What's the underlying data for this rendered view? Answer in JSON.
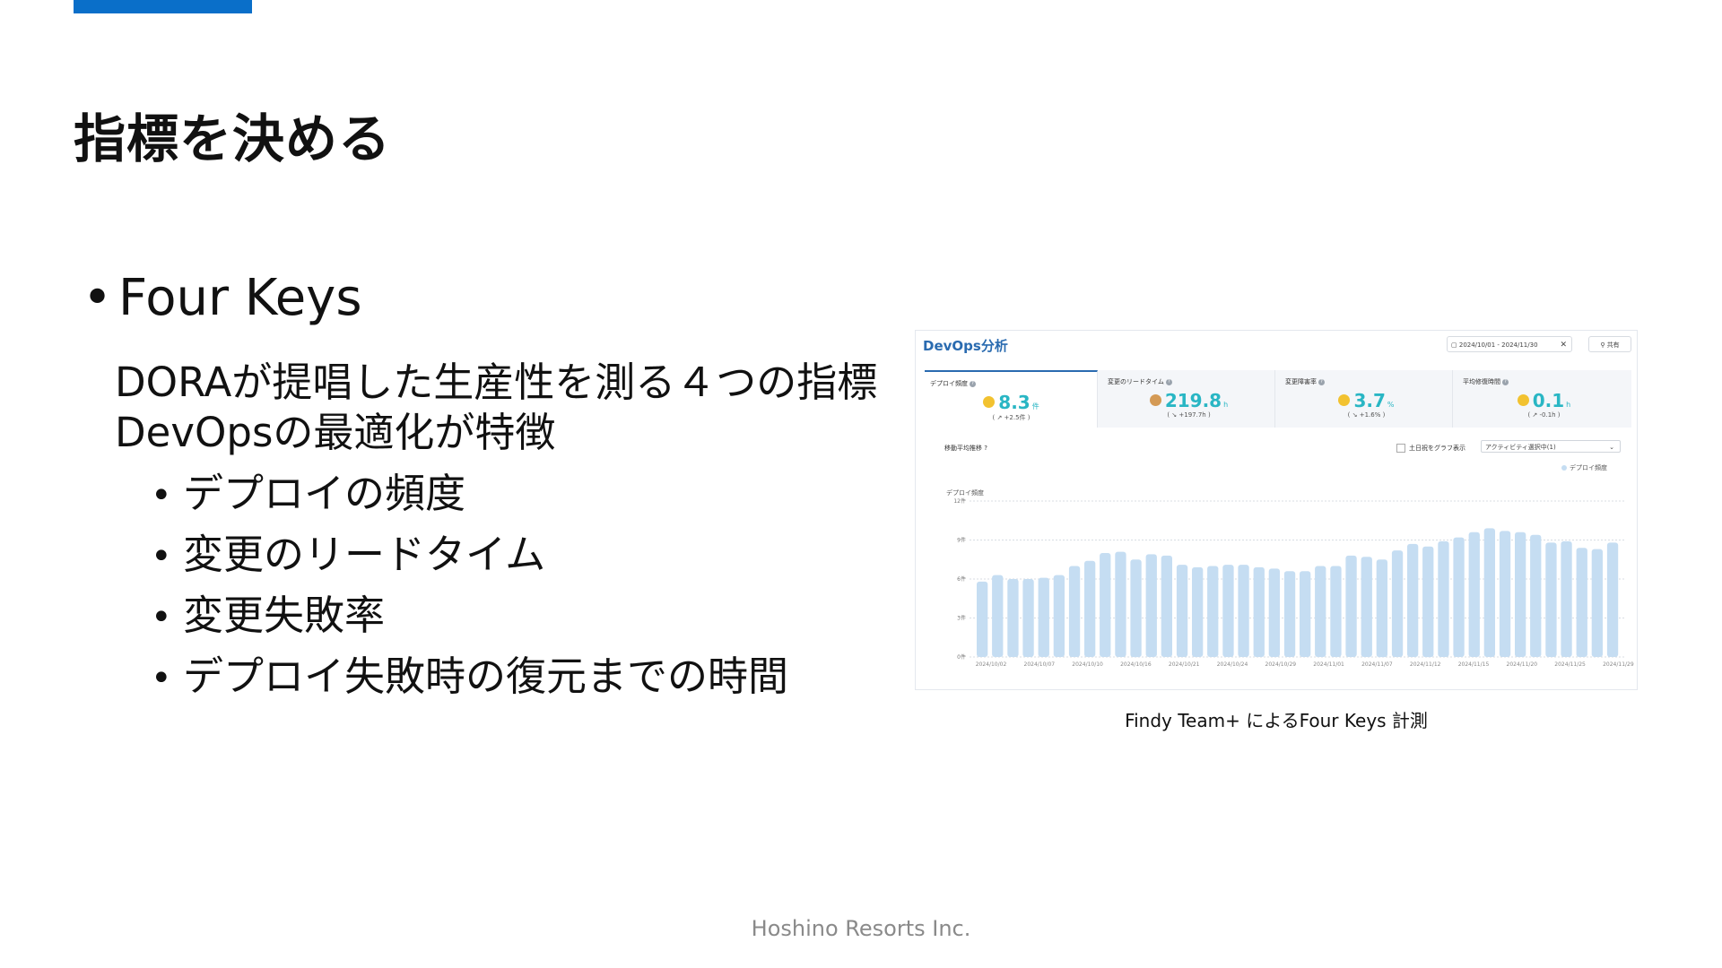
{
  "slide": {
    "title": "指標を決める",
    "bullet1": "Four Keys",
    "description": [
      "DORAが提唱した生産性を測る４つの指標",
      "DevOpsの最適化が特徴"
    ],
    "subitems": [
      "デプロイの頻度",
      "変更のリードタイム",
      "変更失敗率",
      "デプロイ失敗時の復元までの時間"
    ],
    "caption": "Findy Team+ によるFour Keys 計測",
    "footer": "Hoshino Resorts Inc.",
    "accent_color": "#0a6fc9"
  },
  "screenshot": {
    "title": "DevOps分析",
    "date_range": "2024/10/01 - 2024/11/30",
    "share_label": "共有",
    "kpis": [
      {
        "label": "デプロイ頻度",
        "value": "8.3",
        "unit": "件",
        "delta": "( ↗ +2.5件 )",
        "medal": "gold",
        "active": true
      },
      {
        "label": "変更のリードタイム",
        "value": "219.8",
        "unit": "h",
        "delta": "( ↘ +197.7h )",
        "medal": "bronze",
        "active": false
      },
      {
        "label": "変更障害率",
        "value": "3.7",
        "unit": "%",
        "delta": "( ↘ +1.6% )",
        "medal": "gold",
        "active": false
      },
      {
        "label": "平均修復時間",
        "value": "0.1",
        "unit": "h",
        "delta": "( ↗ -0.1h )",
        "medal": "gold",
        "active": false
      }
    ],
    "sub_label": "移動平均推移",
    "checkbox_label": "土日祝をグラフ表示",
    "select_value": "アクティビティ選択中(1)",
    "legend_label": "デプロイ頻度"
  },
  "chart_data": {
    "type": "bar",
    "ylabel": "デプロイ頻度",
    "ylim": [
      0,
      12
    ],
    "yticks": [
      {
        "value": 12,
        "label": "12件"
      },
      {
        "value": 9,
        "label": "9件"
      },
      {
        "value": 6,
        "label": "6件"
      },
      {
        "value": 3,
        "label": "3件"
      },
      {
        "value": 0,
        "label": "0件"
      }
    ],
    "xtick_labels": [
      "2024/10/02",
      "2024/10/07",
      "2024/10/10",
      "2024/10/16",
      "2024/10/21",
      "2024/10/24",
      "2024/10/29",
      "2024/11/01",
      "2024/11/07",
      "2024/11/12",
      "2024/11/15",
      "2024/11/20",
      "2024/11/25",
      "2024/11/29"
    ],
    "series": [
      {
        "name": "デプロイ頻度",
        "color": "#c5ddf2",
        "values": [
          5.8,
          6.3,
          6.0,
          6.0,
          6.1,
          6.3,
          7.0,
          7.4,
          8.0,
          8.1,
          7.5,
          7.9,
          7.8,
          7.1,
          6.9,
          7.0,
          7.1,
          7.1,
          6.9,
          6.8,
          6.6,
          6.6,
          7.0,
          7.0,
          7.8,
          7.7,
          7.5,
          8.2,
          8.7,
          8.5,
          8.9,
          9.2,
          9.6,
          9.9,
          9.7,
          9.6,
          9.4,
          8.8,
          8.9,
          8.4,
          8.3,
          8.8
        ]
      }
    ],
    "grid": true,
    "legend": "top-right"
  }
}
